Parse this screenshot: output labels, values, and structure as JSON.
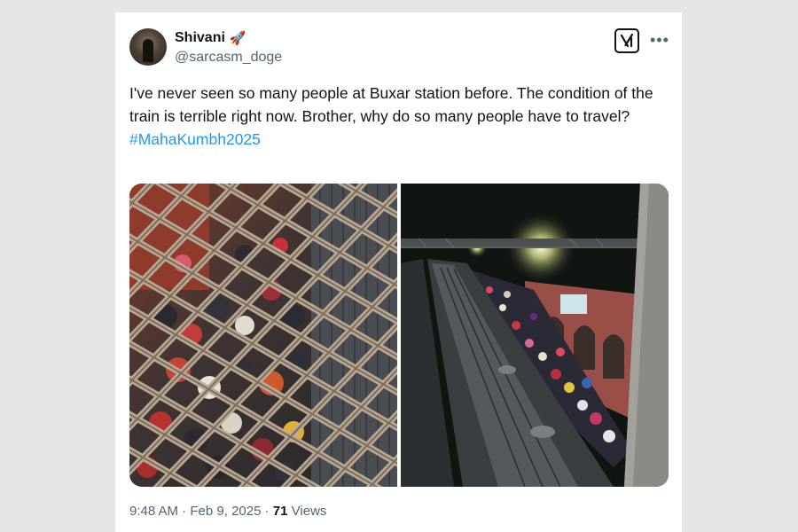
{
  "tweet": {
    "author_name": "Shivani",
    "author_emoji": "🚀",
    "author_handle": "@sarcasm_doge",
    "text": "I've never seen so many people at Buxar station before. The condition of the train is terrible right now. Brother, why do so many people have to travel?",
    "hashtag": "#MahaKumbh2025",
    "time": "9:48 AM",
    "date": "Feb 9, 2025",
    "views_count": "71",
    "views_label": "Views"
  },
  "icons": {
    "logo": "grok-icon",
    "more": "more-icon",
    "avatar": "avatar"
  }
}
